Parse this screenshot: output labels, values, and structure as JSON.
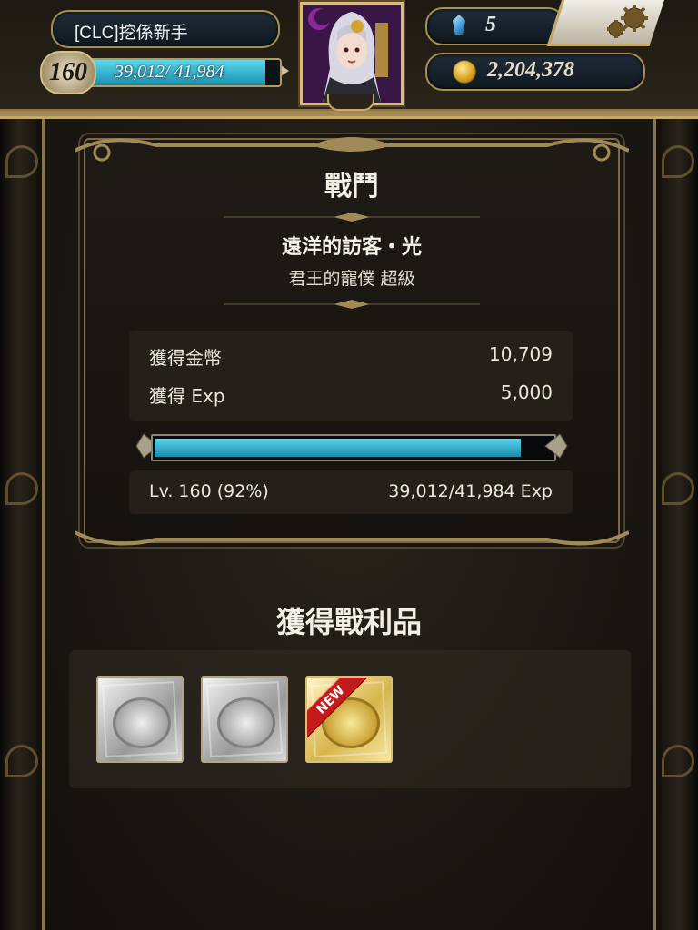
{
  "player": {
    "name": "[CLC]挖係新手",
    "level": "160",
    "exp_text": "39,012/ 41,984",
    "exp_progress": 0.929,
    "gems": "5",
    "coins": "2,204,378"
  },
  "battle": {
    "title": "戰鬥",
    "quest_name": "遠洋的訪客・光",
    "quest_difficulty": "君王的寵僕 超級",
    "rewards": [
      {
        "label": "獲得金幣",
        "value": "10,709"
      },
      {
        "label": "獲得 Exp",
        "value": "5,000"
      }
    ],
    "exp_progress": 0.92,
    "level_text": "Lv. 160 (92%)",
    "exp_detail": "39,012/41,984 Exp"
  },
  "loot": {
    "title": "獲得戰利品",
    "items": [
      {
        "icon": "silver-coin-card-icon",
        "tier": "silver",
        "is_new": false
      },
      {
        "icon": "silver-coin-card-icon",
        "tier": "silver",
        "is_new": false
      },
      {
        "icon": "gold-coin-card-icon",
        "tier": "gold",
        "is_new": true,
        "badge": "NEW"
      }
    ]
  },
  "colors": {
    "accent_gold": "#c7a865",
    "exp_bar": "#2aa7c7",
    "new_badge": "#c31b1b"
  }
}
